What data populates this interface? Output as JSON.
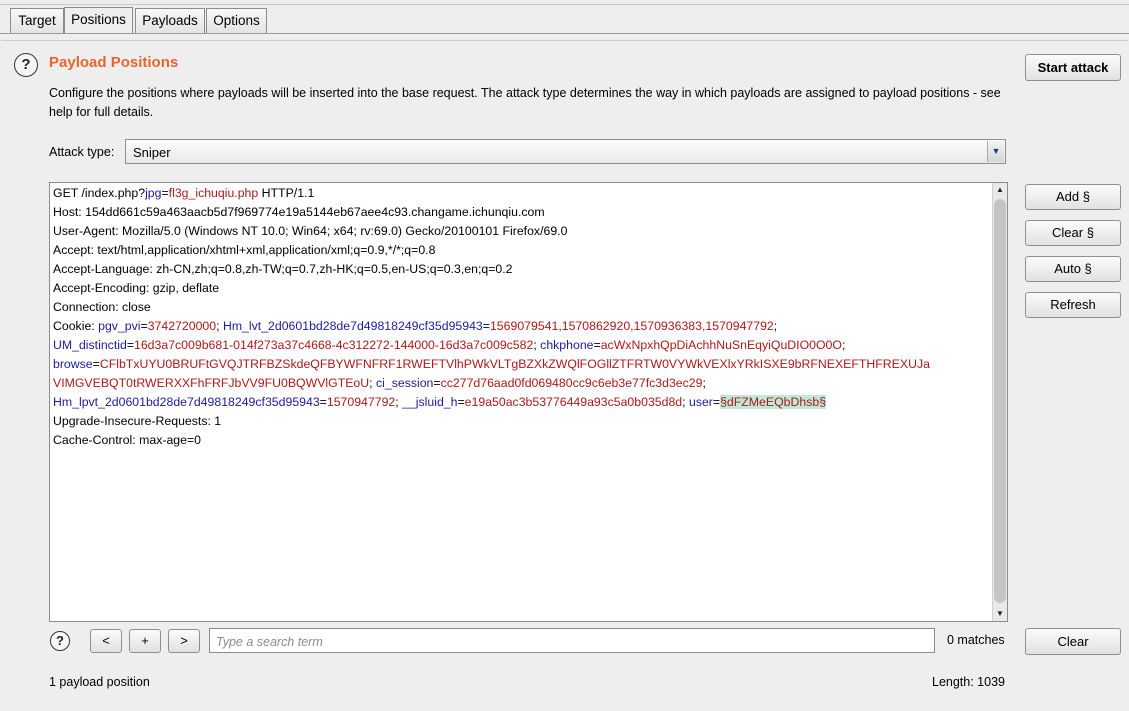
{
  "tabs": [
    {
      "label": "Target"
    },
    {
      "label": "Positions"
    },
    {
      "label": "Payloads"
    },
    {
      "label": "Options"
    }
  ],
  "section": {
    "title": "Payload Positions",
    "description": "Configure the positions where payloads will be inserted into the base request. The attack type determines the way in which payloads are assigned to payload positions - see help for full details.",
    "start_attack_label": "Start attack"
  },
  "attack_type": {
    "label": "Attack type:",
    "value": "Sniper"
  },
  "side_buttons": {
    "add": "Add §",
    "clear": "Clear §",
    "auto": "Auto §",
    "refresh": "Refresh"
  },
  "request_lines": [
    [
      [
        "t",
        "GET /index.php?"
      ],
      [
        "k",
        "jpg"
      ],
      [
        "t",
        "="
      ],
      [
        "v",
        "fl3g_ichuqiu.php"
      ],
      [
        "t",
        " HTTP/1.1"
      ]
    ],
    [
      [
        "t",
        "Host: 154dd661c59a463aacb5d7f969774e19a5144eb67aee4c93.changame.ichunqiu.com"
      ]
    ],
    [
      [
        "t",
        "User-Agent: Mozilla/5.0 (Windows NT 10.0; Win64; x64; rv:69.0) Gecko/20100101 Firefox/69.0"
      ]
    ],
    [
      [
        "t",
        "Accept: text/html,application/xhtml+xml,application/xml;q=0.9,*/*;q=0.8"
      ]
    ],
    [
      [
        "t",
        "Accept-Language: zh-CN,zh;q=0.8,zh-TW;q=0.7,zh-HK;q=0.5,en-US;q=0.3,en;q=0.2"
      ]
    ],
    [
      [
        "t",
        "Accept-Encoding: gzip, deflate"
      ]
    ],
    [
      [
        "t",
        "Connection: close"
      ]
    ],
    [
      [
        "t",
        "Cookie: "
      ],
      [
        "k",
        "pgv_pvi"
      ],
      [
        "t",
        "="
      ],
      [
        "v",
        "3742720000"
      ],
      [
        "t",
        "; "
      ],
      [
        "k",
        "Hm_lvt_2d0601bd28de7d49818249cf35d95943"
      ],
      [
        "t",
        "="
      ],
      [
        "v",
        "1569079541,1570862920,1570936383,1570947792"
      ],
      [
        "t",
        ";"
      ]
    ],
    [
      [
        "k",
        "UM_distinctid"
      ],
      [
        "t",
        "="
      ],
      [
        "v",
        "16d3a7c009b681-014f273a37c4668-4c312272-144000-16d3a7c009c582"
      ],
      [
        "t",
        "; "
      ],
      [
        "k",
        "chkphone"
      ],
      [
        "t",
        "="
      ],
      [
        "v",
        "acWxNpxhQpDiAchhNuSnEqyiQuDIO0O0O"
      ],
      [
        "t",
        ";"
      ]
    ],
    [
      [
        "k",
        "browse"
      ],
      [
        "t",
        "="
      ],
      [
        "v",
        "CFlbTxUYU0BRUFtGVQJTRFBZSkdeQFBYWFNFRF1RWEFTVlhPWkVLTgBZXkZWQlFOGllZTFRTW0VYWkVEXlxYRkISXE9bRFNEXEFTHFREXUJa"
      ]
    ],
    [
      [
        "v",
        "VIMGVEBQT0tRWERXXFhFRFJbVV9FU0BQWVlGTEoU"
      ],
      [
        "t",
        "; "
      ],
      [
        "k",
        "ci_session"
      ],
      [
        "t",
        "="
      ],
      [
        "v",
        "cc277d76aad0fd069480cc9c6eb3e77fc3d3ec29"
      ],
      [
        "t",
        ";"
      ]
    ],
    [
      [
        "k",
        "Hm_lpvt_2d0601bd28de7d49818249cf35d95943"
      ],
      [
        "t",
        "="
      ],
      [
        "v",
        "1570947792"
      ],
      [
        "t",
        "; "
      ],
      [
        "k",
        "__jsluid_h"
      ],
      [
        "t",
        "="
      ],
      [
        "v",
        "e19a50ac3b53776449a93c5a0b035d8d"
      ],
      [
        "t",
        "; "
      ],
      [
        "k",
        "user"
      ],
      [
        "t",
        "="
      ],
      [
        "m",
        "§dFZMeEQbDhsb§"
      ]
    ],
    [
      [
        "t",
        "Upgrade-Insecure-Requests: 1"
      ]
    ],
    [
      [
        "t",
        "Cache-Control: max-age=0"
      ]
    ]
  ],
  "search": {
    "prev_label": "<",
    "add_label": "+",
    "next_label": ">",
    "placeholder": "Type a search term",
    "matches": "0 matches",
    "clear_label": "Clear"
  },
  "status": {
    "positions": "1 payload position",
    "length": "Length: 1039"
  },
  "colors": {
    "title": "#e8642c",
    "param_name": "#1c1c9c",
    "param_value": "#b01818",
    "marker_bg": "#bfe8d8"
  },
  "icons": {
    "help": "question-mark-circle",
    "dropdown": "triangle-down",
    "scroll_up": "triangle-up",
    "scroll_down": "triangle-down"
  }
}
